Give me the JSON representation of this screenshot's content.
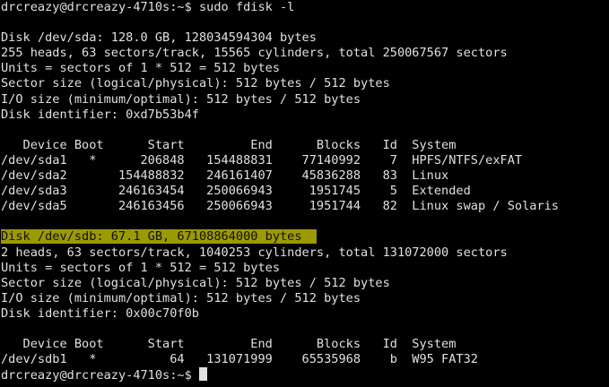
{
  "colors": {
    "background": "#000000",
    "text": "#e0e0e0",
    "highlight": "#9b9a00"
  },
  "terminal": {
    "prompt_top": "drcreazy@drcreazy-4710s:~$ sudo fdisk -l",
    "blank1": "",
    "sda": {
      "line1": "Disk /dev/sda: 128.0 GB, 128034594304 bytes",
      "line2": "255 heads, 63 sectors/track, 15565 cylinders, total 250067567 sectors",
      "line3": "Units = sectors of 1 * 512 = 512 bytes",
      "line4": "Sector size (logical/physical): 512 bytes / 512 bytes",
      "line5": "I/O size (minimum/optimal): 512 bytes / 512 bytes",
      "line6": "Disk identifier: 0xd7b53b4f"
    },
    "blank2": "",
    "sda_table_header": "   Device Boot      Start         End      Blocks   Id  System",
    "sda_table_rows": [
      "/dev/sda1   *      206848   154488831    77140992    7  HPFS/NTFS/exFAT",
      "/dev/sda2       154488832   246161407    45836288   83  Linux",
      "/dev/sda3       246163454   250066943     1951745    5  Extended",
      "/dev/sda5       246163456   250066943     1951744   82  Linux swap / Solaris"
    ],
    "blank3": "",
    "sdb": {
      "line1": "Disk /dev/sdb: 67.1 GB, 67108864000 bytes",
      "line2": "2 heads, 63 sectors/track, 1040253 cylinders, total 131072000 sectors",
      "line3": "Units = sectors of 1 * 512 = 512 bytes",
      "line4": "Sector size (logical/physical): 512 bytes / 512 bytes",
      "line5": "I/O size (minimum/optimal): 512 bytes / 512 bytes",
      "line6": "Disk identifier: 0x00c70f0b"
    },
    "blank4": "",
    "sdb_table_header": "   Device Boot      Start         End      Blocks   Id  System",
    "sdb_table_rows": [
      "/dev/sdb1   *          64   131071999    65535968    b  W95 FAT32"
    ],
    "prompt_bottom": "drcreazy@drcreazy-4710s:~$ "
  }
}
